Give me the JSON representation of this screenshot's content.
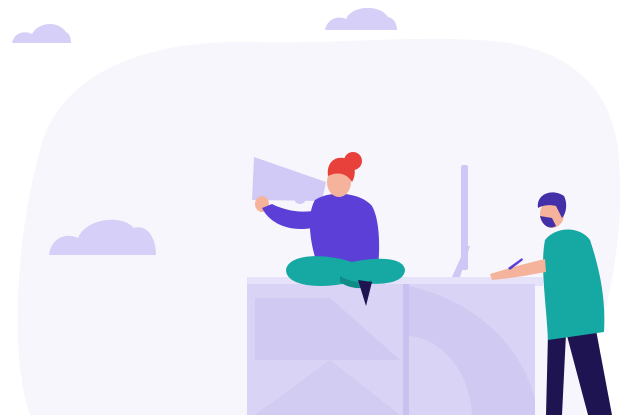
{
  "illustration": {
    "subject": "marketing-team-scene",
    "palette": {
      "blob": "#F7F6FC",
      "cloud": "#D6D0F8",
      "desk_top": "#E6E2F9",
      "desk_front": "#D9D3F5",
      "desk_shadow": "#C9C1EF",
      "megaphone": "#D1CAF6",
      "hoodie": "#5B3FD6",
      "hair_red": "#E8413C",
      "hair_navy": "#4330A8",
      "skin": "#F4B39A",
      "teal": "#16A8A2",
      "teal_dark": "#0F8C87",
      "pants_navy": "#1E1452",
      "monitor": "#CFC8F6"
    },
    "icons": [
      "cloud-icon",
      "megaphone-icon",
      "monitor-icon",
      "pen-icon"
    ]
  }
}
